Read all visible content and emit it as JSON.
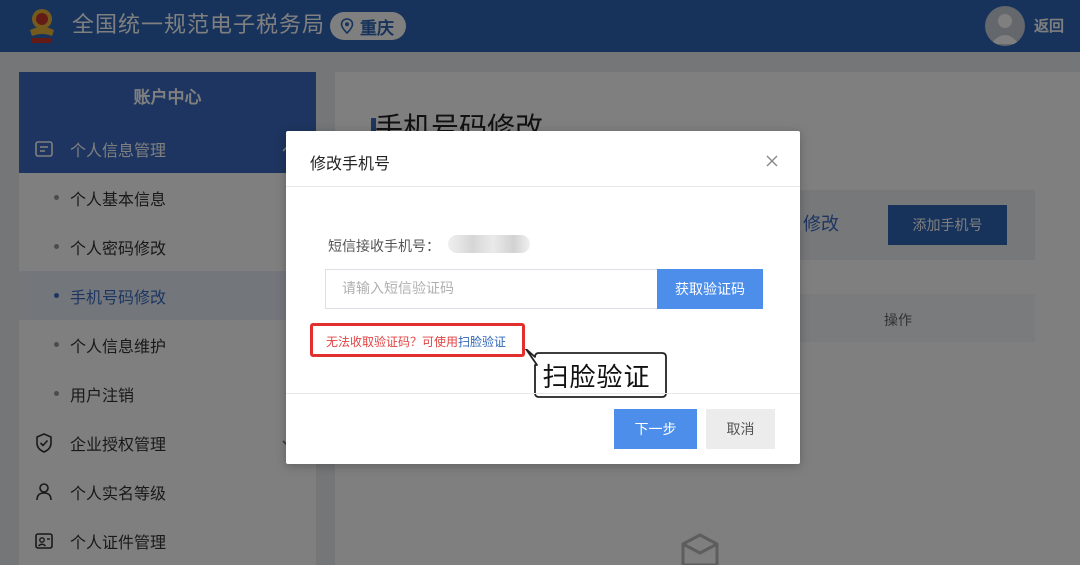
{
  "header": {
    "title": "全国统一规范电子税务局",
    "region": "重庆",
    "back_label": "返回",
    "emblem_icon": "tax-emblem-icon",
    "brand_color": "#2f66b8"
  },
  "sidebar": {
    "heading": "账户中心",
    "items": [
      {
        "label": "个人信息管理",
        "icon": "form-icon",
        "type": "group",
        "expanded": true
      },
      {
        "label": "个人基本信息",
        "type": "sub"
      },
      {
        "label": "个人密码修改",
        "type": "sub"
      },
      {
        "label": "手机号码修改",
        "type": "sub",
        "active": true
      },
      {
        "label": "个人信息维护",
        "type": "sub"
      },
      {
        "label": "用户注销",
        "type": "sub"
      },
      {
        "label": "企业授权管理",
        "icon": "shield-check-icon",
        "type": "group"
      },
      {
        "label": "个人实名等级",
        "icon": "user-icon",
        "type": "group"
      },
      {
        "label": "个人证件管理",
        "icon": "id-card-icon",
        "type": "group"
      }
    ]
  },
  "main": {
    "page_title": "手机号码修改",
    "modify_text": "修改",
    "add_phone_label": "添加手机号",
    "ops_header": "操作"
  },
  "dialog": {
    "title": "修改手机号",
    "phone_label": "短信接收手机号：",
    "code_placeholder": "请输入短信验证码",
    "get_code_label": "获取验证码",
    "help_text": "无法收取验证码？可使用",
    "face_link": "扫脸验证",
    "callout_text": "扫脸验证",
    "next_label": "下一步",
    "cancel_label": "取消",
    "accent_color": "#4d8eea",
    "highlight_color": "#e23030"
  }
}
